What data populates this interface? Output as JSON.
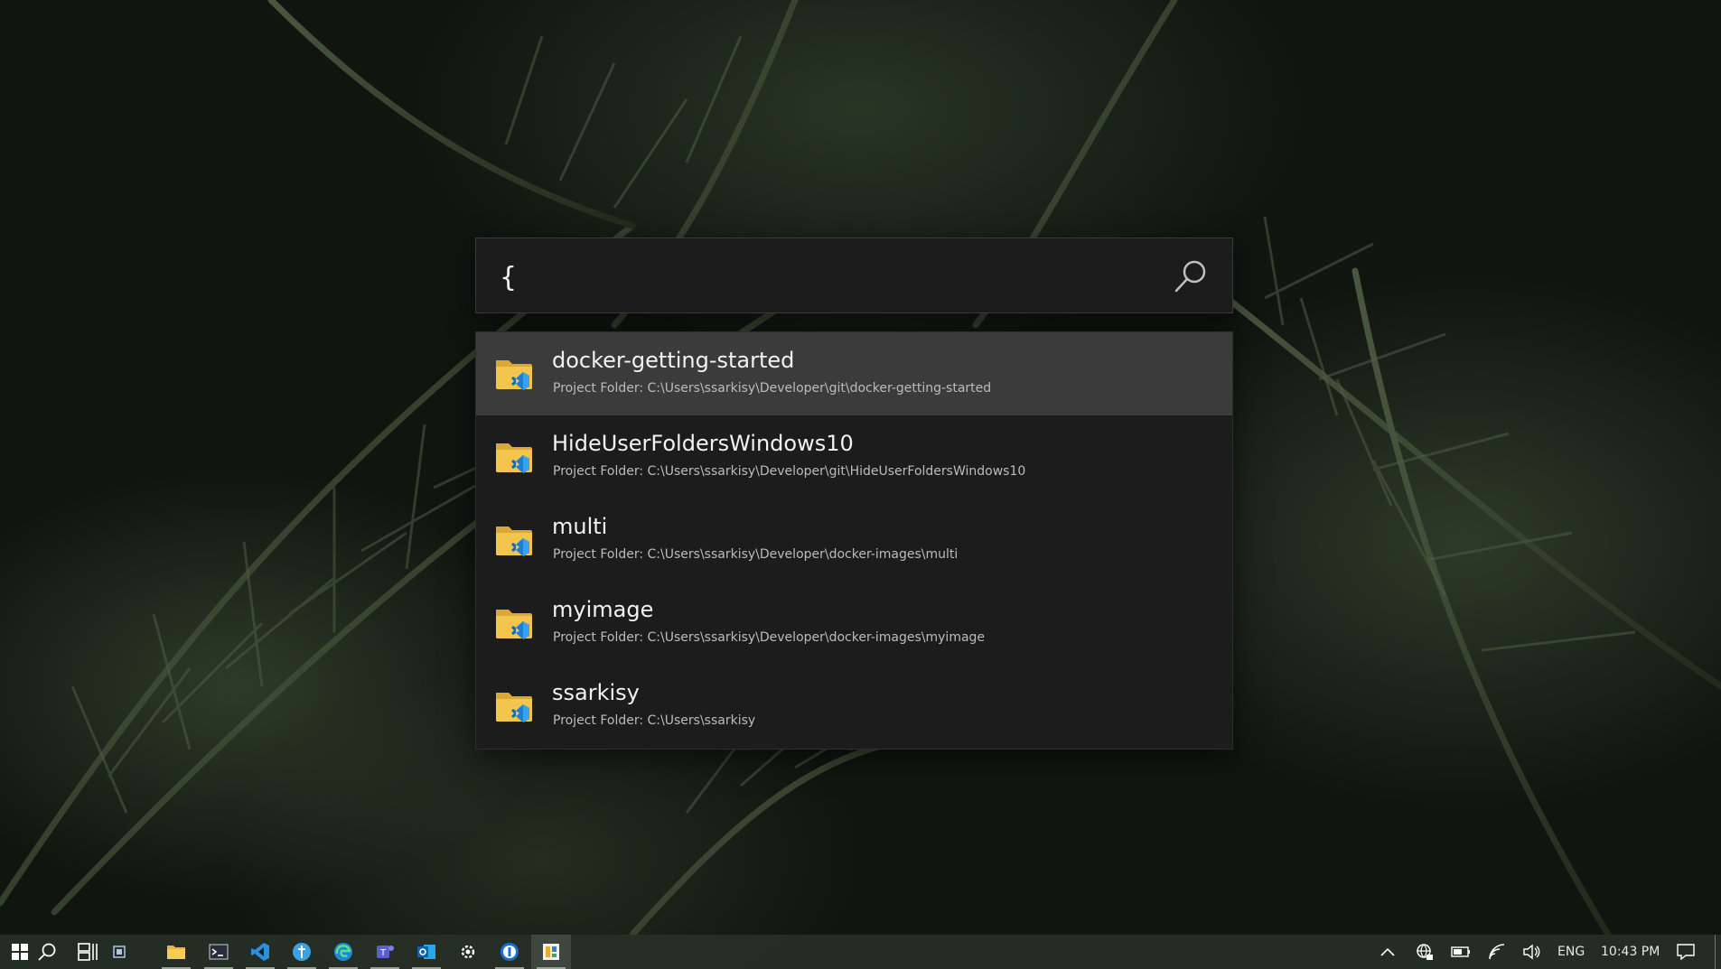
{
  "launcher": {
    "query": "{",
    "results": [
      {
        "title": "docker-getting-started",
        "subtitle": "Project Folder: C:\\Users\\ssarkisy\\Developer\\git\\docker-getting-started",
        "selected": true
      },
      {
        "title": "HideUserFoldersWindows10",
        "subtitle": "Project Folder: C:\\Users\\ssarkisy\\Developer\\git\\HideUserFoldersWindows10",
        "selected": false
      },
      {
        "title": "multi",
        "subtitle": "Project Folder: C:\\Users\\ssarkisy\\Developer\\docker-images\\multi",
        "selected": false
      },
      {
        "title": "myimage",
        "subtitle": "Project Folder: C:\\Users\\ssarkisy\\Developer\\docker-images\\myimage",
        "selected": false
      },
      {
        "title": "ssarkisy",
        "subtitle": "Project Folder: C:\\Users\\ssarkisy",
        "selected": false
      }
    ]
  },
  "taskbar": {
    "apps": [
      "start-icon",
      "search-icon",
      "task-view-icon",
      "widget-icon",
      "file-explorer-icon",
      "terminal-icon",
      "vscode-icon",
      "app-blue-icon",
      "edge-icon",
      "teams-icon",
      "outlook-icon",
      "settings-icon",
      "password-manager-icon",
      "powertoys-icon"
    ],
    "tray": {
      "language": "ENG",
      "time": "10:43 PM"
    }
  },
  "colors": {
    "panel": "#1c1c1c",
    "selected": "#3b3b3b",
    "folder": "#f2c04a",
    "vscode": "#2b8fe0"
  }
}
